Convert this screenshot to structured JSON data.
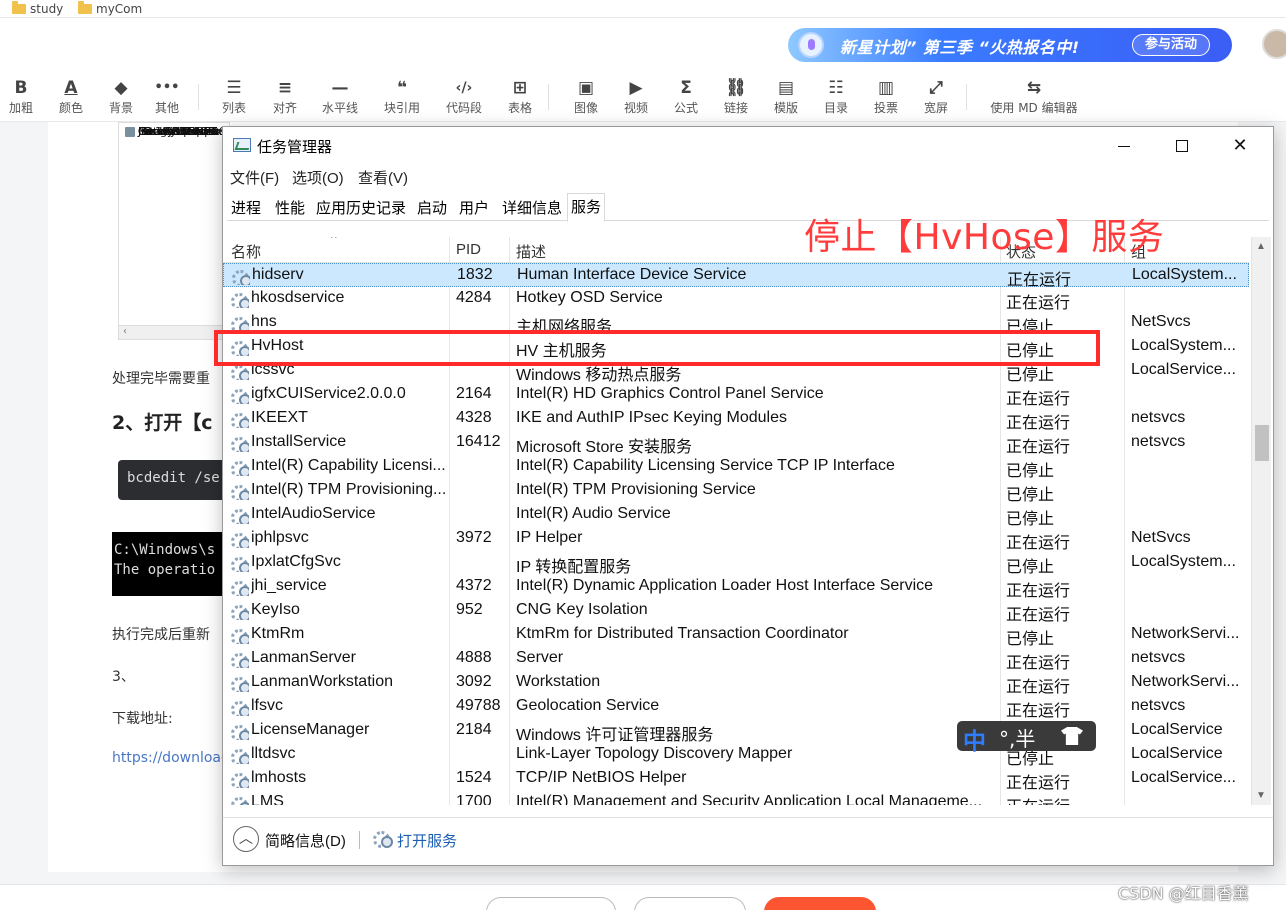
{
  "bookmarks": [
    {
      "label": "study"
    },
    {
      "label": "myCom"
    }
  ],
  "banner": {
    "text": "新星计划” 第三季 “火热报名中!",
    "button": "参与活动"
  },
  "toolbar": {
    "buttons": [
      {
        "icon": "B",
        "label": "加粗"
      },
      {
        "icon": "A",
        "label": "颜色"
      },
      {
        "icon": "◆",
        "label": "背景"
      },
      {
        "icon": "•••",
        "label": "其他"
      },
      {
        "icon": "☰",
        "label": "列表"
      },
      {
        "icon": "≡",
        "label": "对齐"
      },
      {
        "icon": "—",
        "label": "水平线"
      },
      {
        "icon": "❝",
        "label": "块引用"
      },
      {
        "icon": "‹/›",
        "label": "代码段"
      },
      {
        "icon": "⊞",
        "label": "表格"
      },
      {
        "icon": "▣",
        "label": "图像"
      },
      {
        "icon": "▶",
        "label": "视频"
      },
      {
        "icon": "Σ",
        "label": "公式"
      },
      {
        "icon": "⛓",
        "label": "链接"
      },
      {
        "icon": "▤",
        "label": "模版"
      },
      {
        "icon": "☷",
        "label": "目录"
      },
      {
        "icon": "▥",
        "label": "投票"
      },
      {
        "icon": "⤢",
        "label": "宽屏"
      },
      {
        "icon": "⇆",
        "label": "使用 MD 编辑器"
      }
    ]
  },
  "editor": {
    "thumbnail_items": [
      "Camtasia 9",
      "Citrix Workspa",
      "Git version 2.16",
      "Google Chrom",
      "Hotkey OSD Dr",
      "IIS 10.0 Express",
      "Intel® Hardwa",
      "IntelliJ IDEA 20.",
      "Java 8 Update",
      "Java SE Develo",
      "Microsoft .NET"
    ],
    "partial_top_text": "Internet Explorer 11",
    "para1": "处理完毕需要重",
    "heading": "2、打开【c",
    "code": "bcdedit /se",
    "cmd_line1": "C:\\Windows\\s",
    "cmd_line2": "The operatio",
    "para2": "执行完成后重新",
    "para3": "3、",
    "para4": "下载地址:",
    "link": "https://download"
  },
  "bottom_bar": {
    "buttons": [
      "",
      "",
      ""
    ]
  },
  "watermark": "CSDN @红目香薰",
  "task_manager": {
    "title": "任务管理器",
    "menu": [
      "文件(F)",
      "选项(O)",
      "查看(V)"
    ],
    "tabs": [
      "进程",
      "性能",
      "应用历史记录",
      "启动",
      "用户",
      "详细信息",
      "服务"
    ],
    "active_tab": "服务",
    "columns": {
      "name": "名称",
      "pid": "PID",
      "desc": "描述",
      "status": "状态",
      "group": "组"
    },
    "rows": [
      {
        "name": "hidserv",
        "pid": "1832",
        "desc": "Human Interface Device Service",
        "status": "正在运行",
        "group": "LocalSystem...",
        "selected": true
      },
      {
        "name": "hkosdservice",
        "pid": "4284",
        "desc": "Hotkey OSD Service",
        "status": "正在运行",
        "group": ""
      },
      {
        "name": "hns",
        "pid": "",
        "desc": "主机网络服务",
        "status": "已停止",
        "group": "NetSvcs"
      },
      {
        "name": "HvHost",
        "pid": "",
        "desc": "HV 主机服务",
        "status": "已停止",
        "group": "LocalSystem..."
      },
      {
        "name": "icssvc",
        "pid": "",
        "desc": "Windows 移动热点服务",
        "status": "已停止",
        "group": "LocalService..."
      },
      {
        "name": "igfxCUIService2.0.0.0",
        "pid": "2164",
        "desc": "Intel(R) HD Graphics Control Panel Service",
        "status": "正在运行",
        "group": ""
      },
      {
        "name": "IKEEXT",
        "pid": "4328",
        "desc": "IKE and AuthIP IPsec Keying Modules",
        "status": "正在运行",
        "group": "netsvcs"
      },
      {
        "name": "InstallService",
        "pid": "16412",
        "desc": "Microsoft Store 安装服务",
        "status": "正在运行",
        "group": "netsvcs"
      },
      {
        "name": "Intel(R) Capability Licensi...",
        "pid": "",
        "desc": "Intel(R) Capability Licensing Service TCP IP Interface",
        "status": "已停止",
        "group": ""
      },
      {
        "name": "Intel(R) TPM Provisioning...",
        "pid": "",
        "desc": "Intel(R) TPM Provisioning Service",
        "status": "已停止",
        "group": ""
      },
      {
        "name": "IntelAudioService",
        "pid": "",
        "desc": "Intel(R) Audio Service",
        "status": "已停止",
        "group": ""
      },
      {
        "name": "iphlpsvc",
        "pid": "3972",
        "desc": "IP Helper",
        "status": "正在运行",
        "group": "NetSvcs"
      },
      {
        "name": "IpxlatCfgSvc",
        "pid": "",
        "desc": "IP 转换配置服务",
        "status": "已停止",
        "group": "LocalSystem..."
      },
      {
        "name": "jhi_service",
        "pid": "4372",
        "desc": "Intel(R) Dynamic Application Loader Host Interface Service",
        "status": "正在运行",
        "group": ""
      },
      {
        "name": "KeyIso",
        "pid": "952",
        "desc": "CNG Key Isolation",
        "status": "正在运行",
        "group": ""
      },
      {
        "name": "KtmRm",
        "pid": "",
        "desc": "KtmRm for Distributed Transaction Coordinator",
        "status": "已停止",
        "group": "NetworkServi..."
      },
      {
        "name": "LanmanServer",
        "pid": "4888",
        "desc": "Server",
        "status": "正在运行",
        "group": "netsvcs"
      },
      {
        "name": "LanmanWorkstation",
        "pid": "3092",
        "desc": "Workstation",
        "status": "正在运行",
        "group": "NetworkServi..."
      },
      {
        "name": "lfsvc",
        "pid": "49788",
        "desc": "Geolocation Service",
        "status": "正在运行",
        "group": "netsvcs"
      },
      {
        "name": "LicenseManager",
        "pid": "2184",
        "desc": "Windows 许可证管理器服务",
        "status": "正在运行",
        "group": "LocalService"
      },
      {
        "name": "lltdsvc",
        "pid": "",
        "desc": "Link-Layer Topology Discovery Mapper",
        "status": "已停止",
        "group": "LocalService"
      },
      {
        "name": "lmhosts",
        "pid": "1524",
        "desc": "TCP/IP NetBIOS Helper",
        "status": "正在运行",
        "group": "LocalService..."
      },
      {
        "name": "LMS",
        "pid": "1700",
        "desc": "Intel(R) Management and Security Application Local Manageme...",
        "status": "正在运行",
        "group": ""
      }
    ],
    "footer": {
      "less_details": "简略信息(D)",
      "open_services": "打开服务"
    }
  },
  "annotation": {
    "text": "停止【HvHose】服务",
    "color": "#ff2b2b"
  },
  "ime": {
    "mode": "中",
    "rest": "°,半"
  }
}
